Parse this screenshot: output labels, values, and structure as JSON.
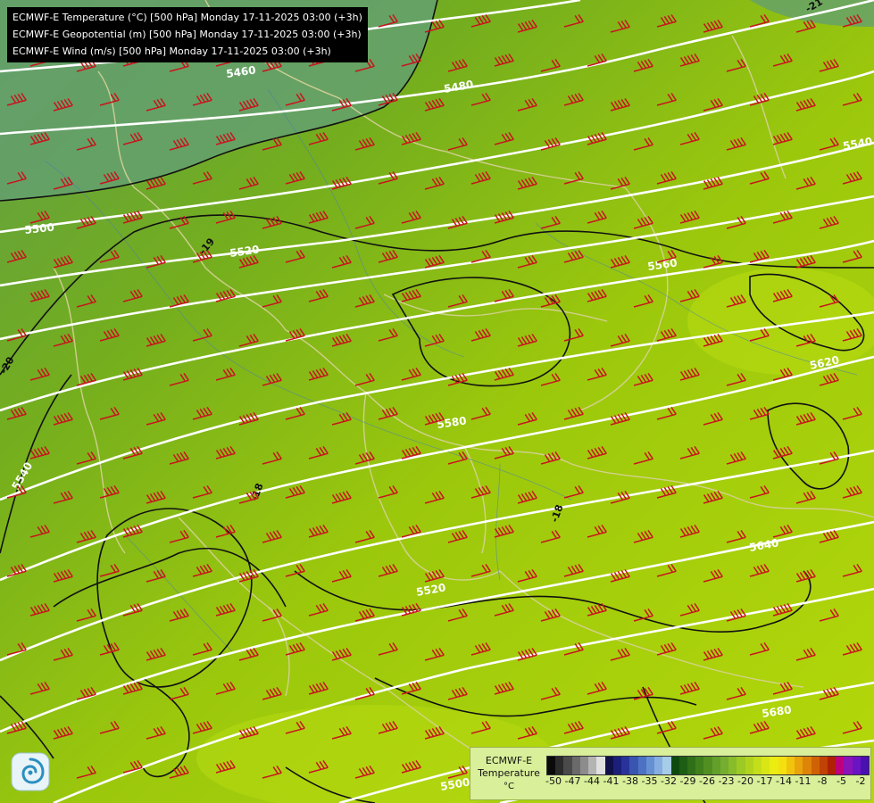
{
  "title_lines": [
    "ECMWF-E Temperature (°C) [500 hPa] Monday 17-11-2025 03:00 (+3h)",
    "ECMWF-E Geopotential (m) [500 hPa] Monday 17-11-2025 03:00 (+3h)",
    "ECMWF-E Wind (m/s) [500 hPa] Monday 17-11-2025 03:00 (+3h)"
  ],
  "legend": {
    "title_line1": "ECMWF-E",
    "title_line2": "Temperature",
    "unit": "°C",
    "tick_labels": [
      "-50",
      "-47",
      "-44",
      "-41",
      "-38",
      "-35",
      "-32",
      "-29",
      "-26",
      "-23",
      "-20",
      "-17",
      "-14",
      "-11",
      "-8",
      "-5",
      "-2"
    ],
    "colors": [
      "#0a0a0a",
      "#2b2b2b",
      "#4a4a4a",
      "#6a6a6a",
      "#8c8c8c",
      "#b4b4b4",
      "#e0e0e0",
      "#10104a",
      "#1b1f7a",
      "#28339a",
      "#3a55b0",
      "#4d72c4",
      "#6690d4",
      "#86aee0",
      "#a6cce8",
      "#0e4a0e",
      "#1d5e14",
      "#2e6f18",
      "#3f801c",
      "#528f22",
      "#63a02a",
      "#75ae2e",
      "#88bc2a",
      "#9cc924",
      "#b0d41e",
      "#c5de1a",
      "#d9e616",
      "#ebec12",
      "#f4e00e",
      "#f0c40c",
      "#e8a40a",
      "#de8408",
      "#d06206",
      "#c04204",
      "#b02004",
      "#c0007a",
      "#8a14b8",
      "#6a14c4",
      "#4a10b0"
    ]
  },
  "contour_labels": [
    "5460",
    "5480",
    "5500",
    "5520",
    "5540",
    "5560",
    "5580",
    "5620",
    "5640",
    "5680",
    "5540",
    "5520",
    "5500",
    "-21",
    "-20",
    "-19",
    "-18",
    "-18",
    "-20",
    "-19"
  ],
  "wind_barb_color": "#c8141e",
  "logo_icon": "ecmwf-swirl-logo-icon"
}
